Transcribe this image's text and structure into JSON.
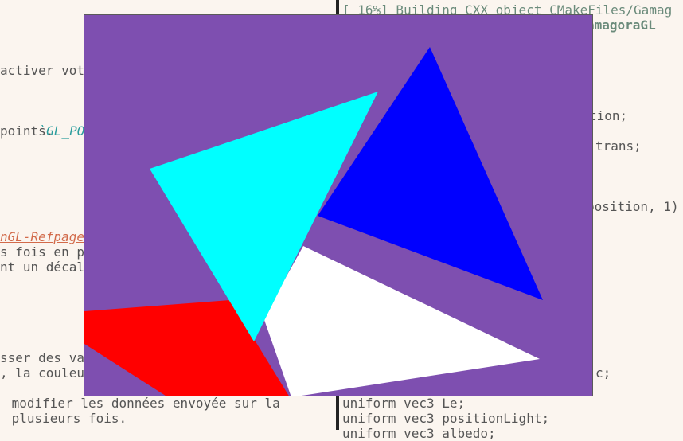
{
  "left_pane": {
    "line1": "activer vot",
    "line2": "`GL_POINTS",
    "line3": "points.",
    "line4": "nGL-Refpage",
    "line5": "s fois en p",
    "line6": "nt un décal",
    "line7": "sser des va",
    "line8": ", la couleu",
    "line9": " modifier les données envoyée sur la",
    "line10": " plusieurs fois."
  },
  "right_pane": {
    "build_line": "[ 16%] Building CXX object CMakeFiles/Gamag",
    "target_name": "amagoraGL",
    "line_tion": "tion;",
    "line_trans": "trans;",
    "line_position": "position, 1)",
    "line_c": "c;",
    "line_le": "uniform vec3 Le;",
    "line_poslight": "uniform vec3 positionLight;",
    "line_partial": "uniform vec3 albedo;"
  },
  "gl_window": {
    "background": "#7e4fb0",
    "triangles": [
      {
        "name": "white-triangle",
        "color": "#ffffff"
      },
      {
        "name": "red-polygon",
        "color": "#ff0000"
      },
      {
        "name": "blue-triangle",
        "color": "#0000ff"
      },
      {
        "name": "cyan-triangle",
        "color": "#00ffff"
      }
    ]
  }
}
